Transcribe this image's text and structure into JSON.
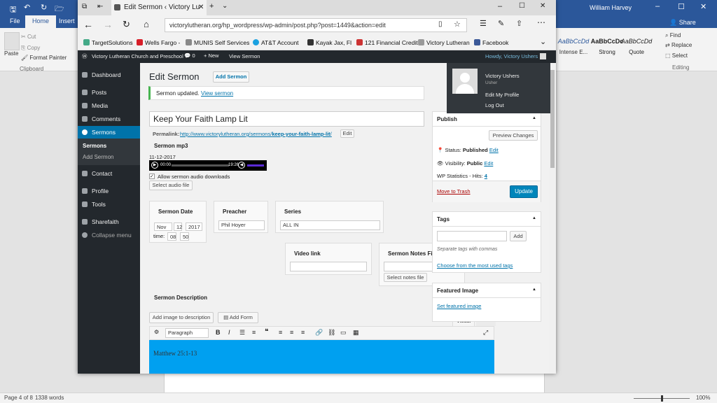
{
  "word": {
    "user": "William Harvey",
    "tabs": [
      "File",
      "Home",
      "Insert"
    ],
    "share": "Share",
    "clipboard": {
      "cut": "Cut",
      "copy": "Copy",
      "paste": "Paste",
      "format_painter": "Format Painter",
      "group": "Clipboard"
    },
    "styles": [
      {
        "sample": "AaBbCcDd",
        "name": "Intense E..."
      },
      {
        "sample": "AaBbCcDc",
        "name": "Strong"
      },
      {
        "sample": "AaBbCcDd",
        "name": "Quote"
      }
    ],
    "editing": {
      "find": "Find",
      "replace": "Replace",
      "select": "Select",
      "group": "Editing"
    },
    "status": {
      "page": "Page 4 of 8",
      "words": "1338 words",
      "zoom": "100%"
    }
  },
  "browser": {
    "tab_title": "Edit Sermon ‹ Victory Lu",
    "url": "victorylutheran.org/hp_wordpress/wp-admin/post.php?post=1449&action=edit",
    "favorites": [
      "TargetSolutions",
      "Wells Fargo -",
      "MUNIS Self Services",
      "AT&T Account",
      "Kayak Jax, Fl",
      "121 Financial Credit",
      "Victory Lutheran",
      "Facebook"
    ]
  },
  "wp": {
    "site_name": "Victory Lutheran Church and Preschool",
    "comments_count": "0",
    "new": "New",
    "view_sermon": "View Sermon",
    "howdy": "Howdy, Victory Ushers",
    "user_menu": {
      "name": "Victory Ushers",
      "role": "Usher",
      "edit_profile": "Edit My Profile",
      "logout": "Log Out"
    },
    "menu": {
      "dashboard": "Dashboard",
      "posts": "Posts",
      "media": "Media",
      "comments": "Comments",
      "sermons": "Sermons",
      "sub_sermons": "Sermons",
      "sub_add": "Add Sermon",
      "contact": "Contact",
      "profile": "Profile",
      "tools": "Tools",
      "sharefaith": "Sharefaith",
      "collapse": "Collapse menu"
    },
    "heading": "Edit Sermon",
    "add_sermon": "Add Sermon",
    "notice": "Sermon updated.",
    "notice_link": "View sermon",
    "post_title": "Keep Your Faith Lamp Lit",
    "permalink_label": "Permalink:",
    "permalink_base": "http://www.victorylutheran.org/sermons/",
    "permalink_slug": "keep-your-faith-lamp-lit",
    "permalink_edit": "Edit",
    "mp3_label": "Sermon mp3",
    "mp3_date": "11-12-2017",
    "audio_time": "00:00",
    "audio_duration": "19:26",
    "allow_downloads": "Allow sermon audio downloads",
    "select_audio": "Select audio file",
    "date_label": "Sermon Date",
    "date_month": "Nov",
    "date_day": "12",
    "date_year": "2017",
    "time_label": "time:",
    "time_hour": "08",
    "time_min": "50",
    "preacher_label": "Preacher",
    "preacher": "Phil Hoyer",
    "series_label": "Series",
    "series": "ALL IN",
    "video_label": "Video link",
    "notes_label": "Sermon Notes File",
    "select_notes": "Select notes file",
    "description_label": "Sermon Description",
    "add_image": "Add image to description",
    "add_form": "Add Form",
    "tab_visual": "Visual",
    "tab_text": "Text",
    "paragraph": "Paragraph",
    "editor_text": "Matthew 25:1-13",
    "publish": {
      "title": "Publish",
      "preview": "Preview Changes",
      "status_label": "Status:",
      "status": "Published",
      "edit": "Edit",
      "visibility_label": "Visibility:",
      "visibility": "Public",
      "stats": "WP Statistics - Hits:",
      "hits": "4",
      "trash": "Move to Trash",
      "update": "Update"
    },
    "tags": {
      "title": "Tags",
      "add": "Add",
      "hint": "Separate tags with commas",
      "choose": "Choose from the most used tags"
    },
    "featured_title": "Featured Image",
    "featured_link": "Set featured image"
  },
  "colors": {
    "word_blue": "#2b579a",
    "wp_dark": "#23282d",
    "wp_blue": "#0073aa",
    "active_menu": "#0073aa",
    "editor_bg": "#00a0f0"
  }
}
